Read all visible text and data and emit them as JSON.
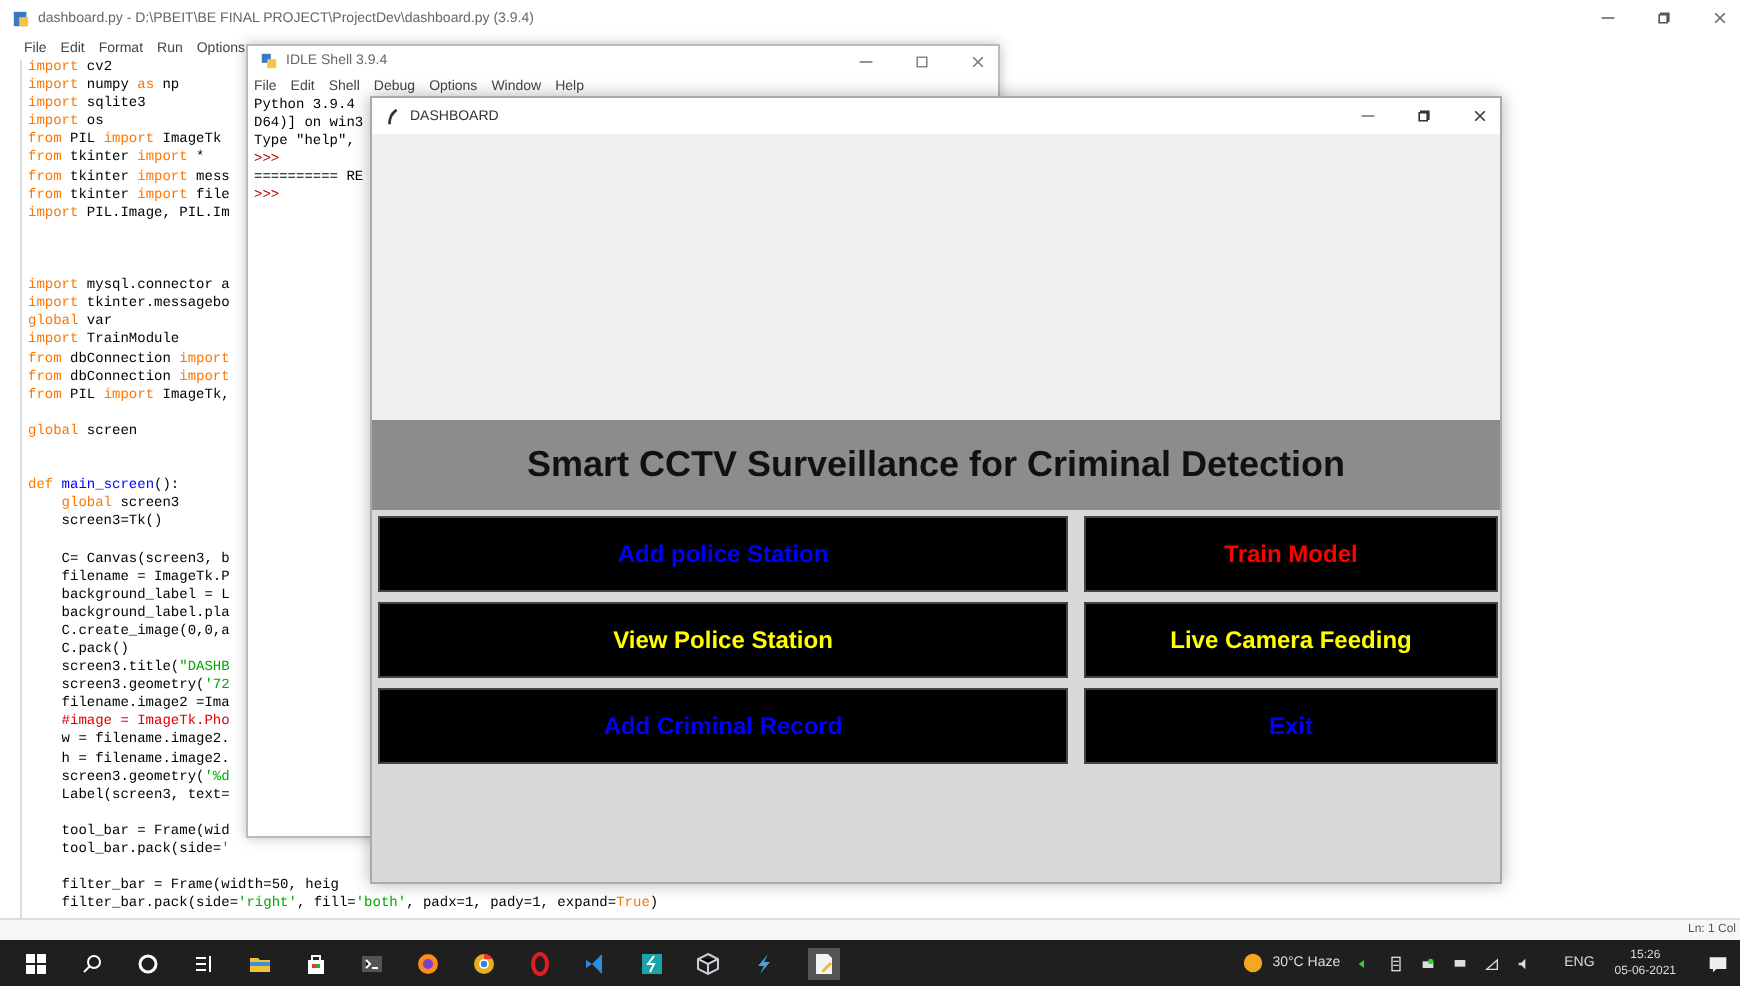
{
  "editor": {
    "title": "dashboard.py - D:\\PBEIT\\BE FINAL PROJECT\\ProjectDev\\dashboard.py (3.9.4)",
    "menu": [
      "File",
      "Edit",
      "Format",
      "Run",
      "Options"
    ],
    "lines": [
      {
        "kind": "code",
        "segments": [
          {
            "kind": "kw",
            "text": "import"
          },
          {
            "kind": "plain",
            "text": " cv2"
          }
        ]
      },
      {
        "kind": "code",
        "segments": [
          {
            "kind": "kw",
            "text": "import"
          },
          {
            "kind": "plain",
            "text": " numpy "
          },
          {
            "kind": "kw",
            "text": "as"
          },
          {
            "kind": "plain",
            "text": " np"
          }
        ]
      },
      {
        "kind": "code",
        "segments": [
          {
            "kind": "kw",
            "text": "import"
          },
          {
            "kind": "plain",
            "text": " sqlite3"
          }
        ]
      },
      {
        "kind": "code",
        "segments": [
          {
            "kind": "kw",
            "text": "import"
          },
          {
            "kind": "plain",
            "text": " os"
          }
        ]
      },
      {
        "kind": "code",
        "segments": [
          {
            "kind": "kw",
            "text": "from"
          },
          {
            "kind": "plain",
            "text": " PIL "
          },
          {
            "kind": "kw",
            "text": "import"
          },
          {
            "kind": "plain",
            "text": " ImageTk"
          }
        ]
      },
      {
        "kind": "code",
        "segments": [
          {
            "kind": "kw",
            "text": "from"
          },
          {
            "kind": "plain",
            "text": " tkinter "
          },
          {
            "kind": "kw",
            "text": "import"
          },
          {
            "kind": "plain",
            "text": " *"
          }
        ]
      },
      {
        "kind": "code",
        "segments": [
          {
            "kind": "kw",
            "text": "from"
          },
          {
            "kind": "plain",
            "text": " tkinter "
          },
          {
            "kind": "kw",
            "text": "import"
          },
          {
            "kind": "plain",
            "text": " mess"
          }
        ]
      },
      {
        "kind": "code",
        "segments": [
          {
            "kind": "kw",
            "text": "from"
          },
          {
            "kind": "plain",
            "text": " tkinter "
          },
          {
            "kind": "kw",
            "text": "import"
          },
          {
            "kind": "plain",
            "text": " file"
          }
        ]
      },
      {
        "kind": "code",
        "segments": [
          {
            "kind": "kw",
            "text": "import"
          },
          {
            "kind": "plain",
            "text": " PIL.Image, PIL.Im"
          }
        ]
      },
      {
        "kind": "blank"
      },
      {
        "kind": "blank"
      },
      {
        "kind": "blank"
      },
      {
        "kind": "code",
        "segments": [
          {
            "kind": "kw",
            "text": "import"
          },
          {
            "kind": "plain",
            "text": " mysql.connector a"
          }
        ]
      },
      {
        "kind": "code",
        "segments": [
          {
            "kind": "kw",
            "text": "import"
          },
          {
            "kind": "plain",
            "text": " tkinter.messagebo"
          }
        ]
      },
      {
        "kind": "code",
        "segments": [
          {
            "kind": "kw",
            "text": "global"
          },
          {
            "kind": "plain",
            "text": " var"
          }
        ]
      },
      {
        "kind": "code",
        "segments": [
          {
            "kind": "kw",
            "text": "import"
          },
          {
            "kind": "plain",
            "text": " TrainModule"
          }
        ]
      },
      {
        "kind": "code",
        "segments": [
          {
            "kind": "kw",
            "text": "from"
          },
          {
            "kind": "plain",
            "text": " dbConnection "
          },
          {
            "kind": "kw",
            "text": "import"
          }
        ]
      },
      {
        "kind": "code",
        "segments": [
          {
            "kind": "kw",
            "text": "from"
          },
          {
            "kind": "plain",
            "text": " dbConnection "
          },
          {
            "kind": "kw",
            "text": "import"
          }
        ]
      },
      {
        "kind": "code",
        "segments": [
          {
            "kind": "kw",
            "text": "from"
          },
          {
            "kind": "plain",
            "text": " PIL "
          },
          {
            "kind": "kw",
            "text": "import"
          },
          {
            "kind": "plain",
            "text": " ImageTk,"
          }
        ]
      },
      {
        "kind": "blank"
      },
      {
        "kind": "code",
        "segments": [
          {
            "kind": "kw",
            "text": "global"
          },
          {
            "kind": "plain",
            "text": " screen"
          }
        ]
      },
      {
        "kind": "blank"
      },
      {
        "kind": "blank"
      },
      {
        "kind": "code",
        "segments": [
          {
            "kind": "kw",
            "text": "def"
          },
          {
            "kind": "def",
            "text": " main_screen"
          },
          {
            "kind": "plain",
            "text": "():"
          }
        ]
      },
      {
        "kind": "code",
        "segments": [
          {
            "kind": "kw",
            "text": "    global"
          },
          {
            "kind": "plain",
            "text": " screen3"
          }
        ]
      },
      {
        "kind": "code",
        "segments": [
          {
            "kind": "plain",
            "text": "    screen3=Tk()"
          }
        ]
      },
      {
        "kind": "blank"
      },
      {
        "kind": "code",
        "segments": [
          {
            "kind": "plain",
            "text": "    C= Canvas(screen3, b"
          }
        ]
      },
      {
        "kind": "code",
        "segments": [
          {
            "kind": "plain",
            "text": "    filename = ImageTk.P"
          }
        ]
      },
      {
        "kind": "code",
        "segments": [
          {
            "kind": "plain",
            "text": "    background_label = L"
          }
        ]
      },
      {
        "kind": "code",
        "segments": [
          {
            "kind": "plain",
            "text": "    background_label.pla"
          }
        ]
      },
      {
        "kind": "code",
        "segments": [
          {
            "kind": "plain",
            "text": "    C.create_image(0,0,a"
          }
        ]
      },
      {
        "kind": "code",
        "segments": [
          {
            "kind": "plain",
            "text": "    C.pack()"
          }
        ]
      },
      {
        "kind": "code",
        "segments": [
          {
            "kind": "plain",
            "text": "    screen3.title("
          },
          {
            "kind": "str",
            "text": "\"DASHB"
          }
        ]
      },
      {
        "kind": "code",
        "segments": [
          {
            "kind": "plain",
            "text": "    screen3.geometry("
          },
          {
            "kind": "str",
            "text": "'72"
          }
        ]
      },
      {
        "kind": "code",
        "segments": [
          {
            "kind": "plain",
            "text": "    filename.image2 =Ima"
          }
        ]
      },
      {
        "kind": "code",
        "segments": [
          {
            "kind": "comment",
            "text": "    #image = ImageTk.Pho"
          }
        ]
      },
      {
        "kind": "code",
        "segments": [
          {
            "kind": "plain",
            "text": "    w = filename.image2."
          }
        ]
      },
      {
        "kind": "code",
        "segments": [
          {
            "kind": "plain",
            "text": "    h = filename.image2."
          }
        ]
      },
      {
        "kind": "code",
        "segments": [
          {
            "kind": "plain",
            "text": "    screen3.geometry("
          },
          {
            "kind": "str",
            "text": "'%d"
          }
        ]
      },
      {
        "kind": "code",
        "segments": [
          {
            "kind": "plain",
            "text": "    Label(screen3, text="
          }
        ]
      },
      {
        "kind": "blank"
      },
      {
        "kind": "code",
        "segments": [
          {
            "kind": "plain",
            "text": "    tool_bar = Frame(wid"
          }
        ]
      },
      {
        "kind": "code",
        "segments": [
          {
            "kind": "plain",
            "text": "    tool_bar.pack(side="
          },
          {
            "kind": "str",
            "text": "'"
          }
        ]
      },
      {
        "kind": "blank"
      },
      {
        "kind": "code",
        "segments": [
          {
            "kind": "plain",
            "text": "    filter_bar = Frame(width=50, heig"
          }
        ]
      },
      {
        "kind": "code",
        "segments": [
          {
            "kind": "plain",
            "text": "    filter_bar.pack(side="
          },
          {
            "kind": "str",
            "text": "'right'"
          },
          {
            "kind": "plain",
            "text": ", fill="
          },
          {
            "kind": "str",
            "text": "'both'"
          },
          {
            "kind": "plain",
            "text": ", padx=1, pady=1, expand="
          },
          {
            "kind": "kw",
            "text": "True"
          },
          {
            "kind": "plain",
            "text": ")"
          }
        ]
      }
    ],
    "status": "Ln: 1 Col"
  },
  "shell": {
    "title": "IDLE Shell 3.9.4",
    "menu": [
      "File",
      "Edit",
      "Shell",
      "Debug",
      "Options",
      "Window",
      "Help"
    ],
    "lines": [
      {
        "kind": "output",
        "text": "Python 3.9.4"
      },
      {
        "kind": "output",
        "text": "D64)] on win3"
      },
      {
        "kind": "output",
        "text": "Type \"help\","
      },
      {
        "kind": "prompt",
        "text": ">>>"
      },
      {
        "kind": "output",
        "text": "========== RE"
      },
      {
        "kind": "prompt",
        "text": ">>>"
      }
    ]
  },
  "dashboard": {
    "title": "DASHBOARD",
    "heading": "Smart CCTV Surveillance for Criminal Detection",
    "buttons": [
      {
        "label": "Add police Station",
        "color": "#0000ff"
      },
      {
        "label": "Train Model",
        "color": "#ff0000"
      },
      {
        "label": "View Police Station",
        "color": "#ffff00"
      },
      {
        "label": "Live Camera Feeding",
        "color": "#ffff00"
      },
      {
        "label": "Add Criminal Record",
        "color": "#0000ff"
      },
      {
        "label": "Exit",
        "color": "#0000ff"
      }
    ]
  },
  "taskbar": {
    "weather": "30°C Haze",
    "language": "ENG",
    "time": "15:26",
    "date": "05-06-2021"
  }
}
